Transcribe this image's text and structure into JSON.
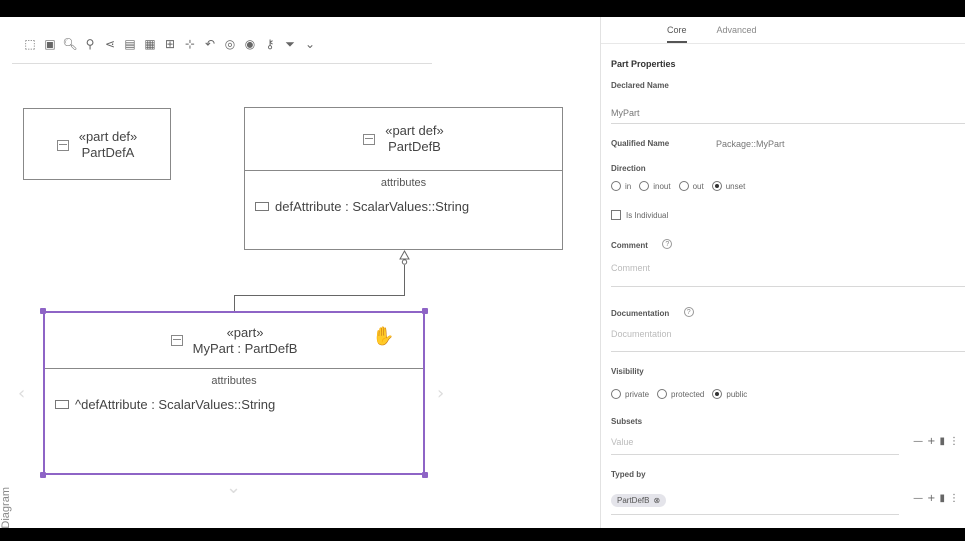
{
  "toolbar": {
    "icons": [
      "fit-to-screen-icon",
      "export-image-icon",
      "zoom-in-icon",
      "zoom-out-icon",
      "share-icon",
      "arrange-all-icon",
      "layout-icon",
      "align-icon",
      "snap-icon",
      "undo-icon",
      "hide-icon",
      "fade-icon",
      "pin-icon",
      "filter-icon",
      "more-icon"
    ]
  },
  "diagram": {
    "nodeA": {
      "stereotype": "«part def»",
      "name": "PartDefA"
    },
    "nodeB": {
      "stereotype": "«part def»",
      "name": "PartDefB",
      "compartment": "attributes",
      "attribute": "defAttribute : ScalarValues::String"
    },
    "nodeC": {
      "stereotype": "«part»",
      "name": "MyPart : PartDefB",
      "compartment": "attributes",
      "attribute": "^defAttribute : ScalarValues::String"
    },
    "side_label": "Diagram"
  },
  "panel": {
    "tabs": [
      "Core",
      "Advanced"
    ],
    "active_tab": "Core",
    "section_title": "Part Properties",
    "declared_name_label": "Declared Name",
    "declared_name_value": "MyPart",
    "qualified_name_label": "Qualified Name",
    "qualified_name_value": "Package::MyPart",
    "direction_label": "Direction",
    "direction_options": [
      "in",
      "inout",
      "out",
      "unset"
    ],
    "direction_selected": "unset",
    "is_individual_label": "Is Individual",
    "comment_label": "Comment",
    "comment_placeholder": "Comment",
    "documentation_label": "Documentation",
    "documentation_placeholder": "Documentation",
    "visibility_label": "Visibility",
    "visibility_options": [
      "private",
      "protected",
      "public"
    ],
    "visibility_selected": "public",
    "subsets_label": "Subsets",
    "subsets_placeholder": "Value",
    "typed_by_label": "Typed by",
    "typed_by_chip": "PartDefB"
  },
  "colors": {
    "selection": "#8e64c6"
  }
}
